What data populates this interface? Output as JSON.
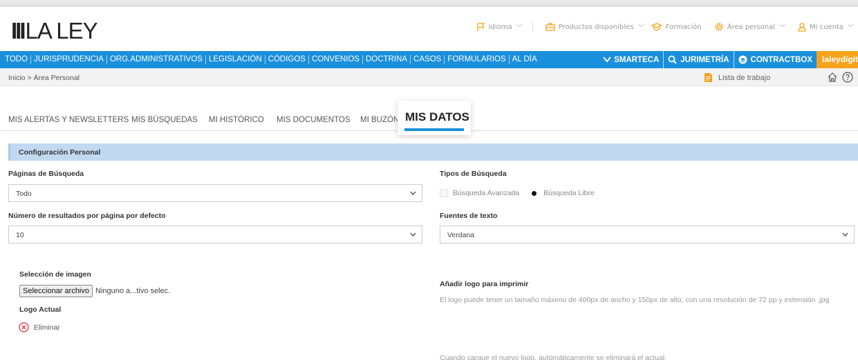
{
  "brand": {
    "logo_bars": "III",
    "logo_text": "LA LEY"
  },
  "topnav": {
    "idioma": "Idioma",
    "productos": "Productos disponibles",
    "formacion": "Formación",
    "area_personal": "Área personal",
    "mi_cuenta": "Mi cuenta"
  },
  "menu": {
    "items": [
      "TODO",
      "JURISPRUDENCIA",
      "ORG.ADMINISTRATIVOS",
      "LEGISLACIÓN",
      "CÓDIGOS",
      "CONVENIOS",
      "DOCTRINA",
      "CASOS",
      "FORMULARIOS",
      "AL DÍA"
    ],
    "smarteca": "SMARTECA",
    "jurimetria": "JURIMETRÍA",
    "contractbox": "CONTRACTBOX",
    "digital": "laleydigital"
  },
  "breadcrumb": "Inicio > Área Personal",
  "worklist": "Lista de trabajo",
  "tabs": {
    "alertas": "MIS ALERTAS Y NEWSLETTERS",
    "busquedas": "MIS BÚSQUEDAS",
    "historico": "MI HISTÓRICO",
    "documentos": "MIS DOCUMENTOS",
    "buzon": "MI BUZÓN",
    "datos": "MIS DATOS"
  },
  "section_title": "Configuración Personal",
  "form": {
    "paginas_label": "Páginas de Búsqueda",
    "paginas_value": "Todo",
    "resultados_label": "Número de resultados por página por defecto",
    "resultados_value": "10",
    "tipos_label": "Tipos de Búsqueda",
    "tipo_avanzada": "Búsqueda Avanzada",
    "tipo_libre": "Búsqueda Libre",
    "fuentes_label": "Fuentes de texto",
    "fuentes_value": "Verdana",
    "imagen_label": "Selección de imagen",
    "file_button": "Seleccionar archivo",
    "file_name": "Ninguno a...tivo selec.",
    "logo_actual_label": "Logo Actual",
    "eliminar": "Eliminar",
    "logo_print_label": "Añadir logo para imprimir",
    "logo_print_desc": "El logo puede tener un tamaño máximo de 400px de ancho y 150px de alto, con una resolución de 72 pp y extensión .jpg",
    "logo_print_note": "Cuando cargue el nuevo logo, automáticamente se eliminará el actual."
  },
  "colors": {
    "accent": "#1a8fdc",
    "orange": "#f7a21b",
    "section": "#c2daf1",
    "delete": "#e0353b"
  }
}
